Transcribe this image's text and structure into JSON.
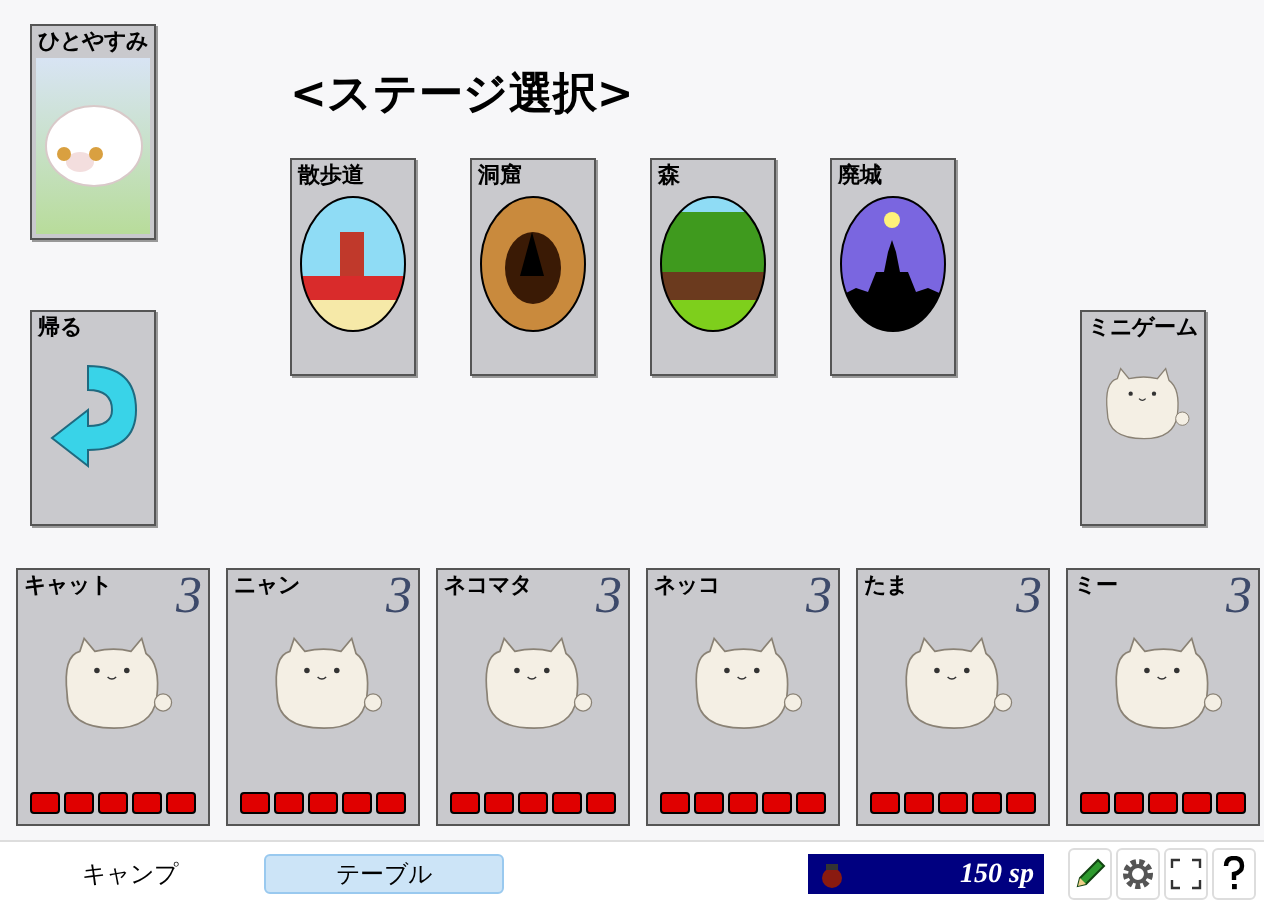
{
  "rest_card": {
    "label": "ひとやすみ"
  },
  "back_card": {
    "label": "帰る"
  },
  "title": "<ステージ選択>",
  "stages": [
    {
      "label": "散歩道",
      "kind": "path"
    },
    {
      "label": "洞窟",
      "kind": "cave"
    },
    {
      "label": "森",
      "kind": "forest"
    },
    {
      "label": "廃城",
      "kind": "castle"
    }
  ],
  "minigame_card": {
    "label": "ミニゲーム"
  },
  "cats": [
    {
      "name": "キャット",
      "cost": "3",
      "pips": [
        {
          "filled": true
        },
        {
          "filled": true
        },
        {
          "filled": true
        },
        {
          "filled": true
        },
        {
          "filled": true
        }
      ]
    },
    {
      "name": "ニャン",
      "cost": "3",
      "pips": [
        {
          "filled": true
        },
        {
          "filled": true
        },
        {
          "filled": true
        },
        {
          "filled": true
        },
        {
          "filled": true
        }
      ]
    },
    {
      "name": "ネコマタ",
      "cost": "3",
      "pips": [
        {
          "filled": true
        },
        {
          "filled": true
        },
        {
          "filled": true
        },
        {
          "filled": true
        },
        {
          "filled": true
        }
      ]
    },
    {
      "name": "ネッコ",
      "cost": "3",
      "pips": [
        {
          "filled": true
        },
        {
          "filled": true
        },
        {
          "filled": true
        },
        {
          "filled": true
        },
        {
          "filled": true
        }
      ]
    },
    {
      "name": "たま",
      "cost": "3",
      "pips": [
        {
          "filled": true
        },
        {
          "filled": true
        },
        {
          "filled": true
        },
        {
          "filled": true
        },
        {
          "filled": true
        }
      ]
    },
    {
      "name": "ミー",
      "cost": "3",
      "pips": [
        {
          "filled": true
        },
        {
          "filled": true
        },
        {
          "filled": true
        },
        {
          "filled": true
        },
        {
          "filled": true
        }
      ]
    }
  ],
  "tabs": [
    {
      "label": "キャンプ",
      "selected": false
    },
    {
      "label": "テーブル",
      "selected": true
    }
  ],
  "money": "150 sp",
  "toolbar": [
    {
      "kind": "pencil"
    },
    {
      "kind": "settings"
    },
    {
      "kind": "fullscreen"
    },
    {
      "kind": "help"
    }
  ]
}
